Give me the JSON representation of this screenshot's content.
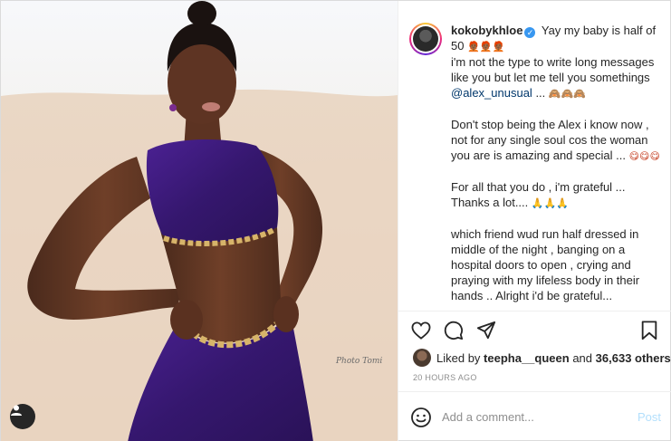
{
  "post": {
    "username": "kokobykhloe",
    "caption_lines": [
      {
        "type": "head",
        "text": "Yay my baby is half of 50",
        "emoji": "🧑🏾‍🦰🧑🏾‍🦰🧑🏾‍🦰"
      },
      {
        "type": "text",
        "text": "i'm not the type to write long messages like you but let me tell you somethings "
      },
      {
        "type": "mention",
        "text": "@alex_unusual"
      },
      {
        "type": "text2",
        "text": " ... "
      },
      {
        "type": "text3",
        "text": "Don't stop being the Alex i know now , not for any single soul cos the woman you are is amazing and special ... "
      },
      {
        "type": "text4",
        "text": "For all that you do , i'm grateful ... Thanks a lot.... "
      },
      {
        "type": "text5",
        "text": "which friend wud run half dressed in middle of the night , banging on a hospital doors to open , crying and praying with my lifeless body in their hands .. Alright i'd be grateful..."
      }
    ],
    "emoji_monkeys": "🙈🙈🙈",
    "emoji_faces": "😋😋😋",
    "emoji_pray": "🙏🙏🙏",
    "likes": {
      "prefix": "Liked by",
      "user": "teepha__queen",
      "mid": "and",
      "count": "36,633 others"
    },
    "timestamp": "20 HOURS AGO",
    "comment": {
      "placeholder": "Add a comment...",
      "post_label": "Post"
    },
    "photo_watermark": "Photo Tomi"
  },
  "icons": {
    "verified": "verified-badge-icon",
    "like": "heart-icon",
    "comment": "comment-bubble-icon",
    "share": "paper-plane-icon",
    "save": "bookmark-icon",
    "emoji": "smiley-icon",
    "tags": "user-tag-icon"
  },
  "colors": {
    "accent": "#3897f0",
    "mention": "#00376b",
    "post_disabled": "#b2dffc",
    "dress": "#3b1a78"
  }
}
